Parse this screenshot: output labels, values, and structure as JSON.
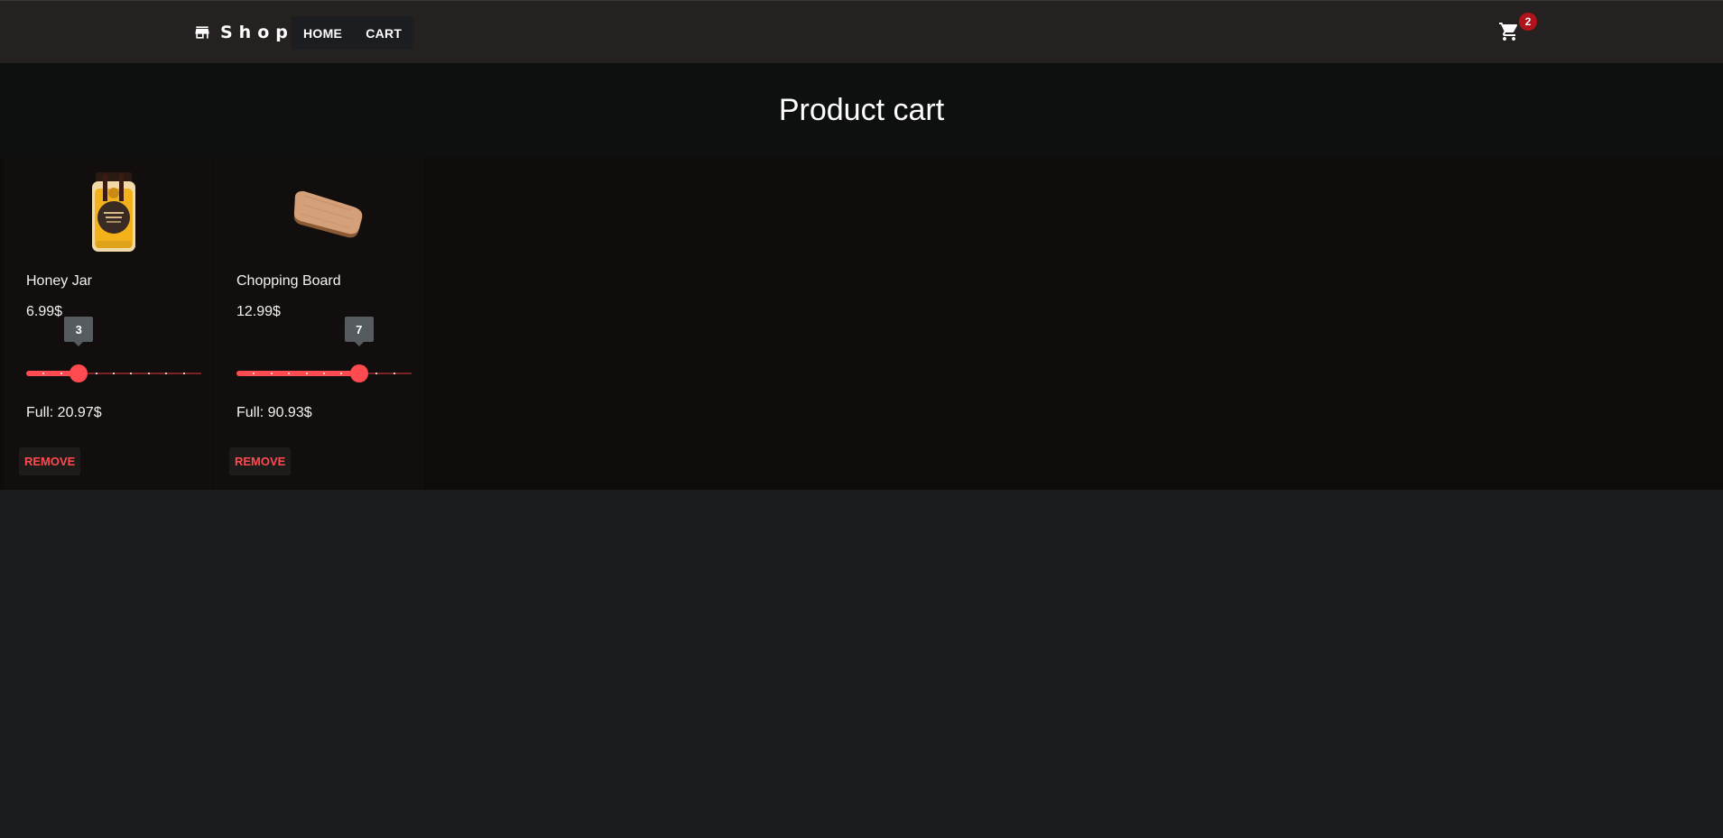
{
  "header": {
    "brand_label": "Shop",
    "nav": [
      {
        "label": "HOME"
      },
      {
        "label": "CART"
      }
    ],
    "cart_count": "2"
  },
  "page": {
    "title": "Product cart"
  },
  "cart": {
    "items": [
      {
        "name": "Honey Jar",
        "price": "6.99$",
        "quantity": "3",
        "quantity_value": 3,
        "quantity_max": 10,
        "full": "Full: 20.97$",
        "remove_label": "REMOVE"
      },
      {
        "name": "Chopping Board",
        "price": "12.99$",
        "quantity": "7",
        "quantity_value": 7,
        "quantity_max": 10,
        "full": "Full: 90.93$",
        "remove_label": "REMOVE"
      }
    ]
  },
  "colors": {
    "accent": "#ff4a4f",
    "badge": "#b0141a",
    "header_bg": "#252120",
    "page_bg": "#1a1b1d"
  },
  "icons": {
    "brand": "store-icon",
    "cart": "shopping-cart-icon"
  }
}
